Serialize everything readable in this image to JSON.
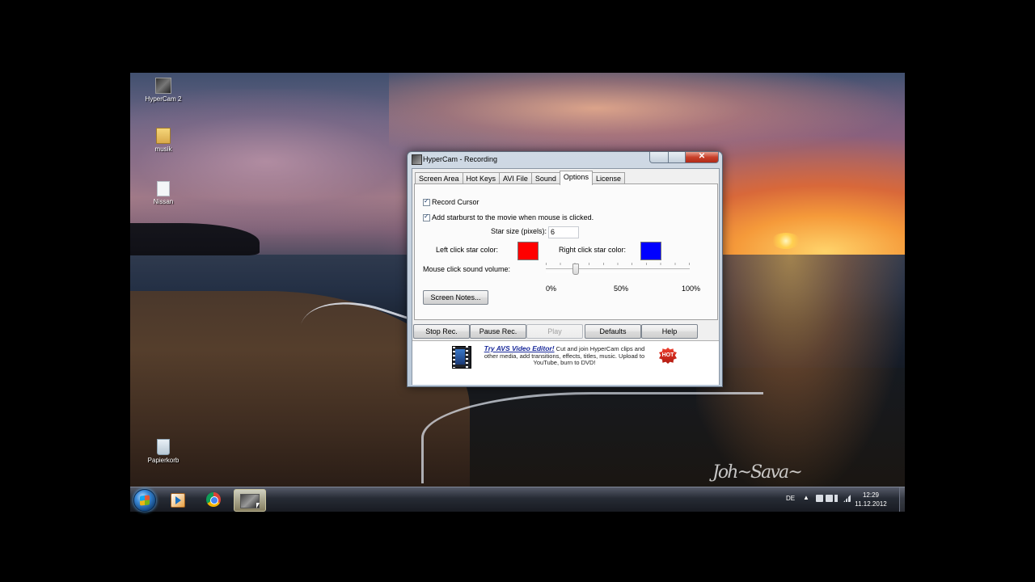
{
  "desktop": {
    "icons": [
      {
        "label": "HyperCam 2",
        "icon": "hypercam-icon"
      },
      {
        "label": "musik",
        "icon": "folder-icon"
      },
      {
        "label": "Nissan",
        "icon": "file-icon"
      },
      {
        "label": "Papierkorb",
        "icon": "recycle-bin-icon"
      }
    ]
  },
  "window": {
    "title": "HyperCam - Recording",
    "close_glyph": "✕",
    "tabs": [
      {
        "label": "Screen Area"
      },
      {
        "label": "Hot Keys"
      },
      {
        "label": "AVI File"
      },
      {
        "label": "Sound"
      },
      {
        "label": "Options",
        "selected": true
      },
      {
        "label": "License"
      }
    ],
    "options": {
      "record_cursor": {
        "label": "Record Cursor",
        "checked": true
      },
      "add_starburst": {
        "label": "Add starburst to the movie when mouse is clicked.",
        "checked": true
      },
      "star_size_label": "Star size (pixels):",
      "star_size_value": "6",
      "left_click_label": "Left click star color:",
      "left_click_color": "#ff0000",
      "right_click_label": "Right click star color:",
      "right_click_color": "#0000ff",
      "volume_label": "Mouse click sound volume:",
      "volume_level": 0.2,
      "volume_ticks": [
        "0%",
        "50%",
        "100%"
      ],
      "screen_notes_label": "Screen Notes..."
    },
    "buttons": {
      "stop": "Stop Rec.",
      "pause": "Pause Rec.",
      "play": "Play",
      "defaults": "Defaults",
      "help": "Help"
    },
    "ad": {
      "link": "Try AVS Video Editor!",
      "line1": "Cut and join HyperCam clips and",
      "line2": "other media, add transitions, effects, titles, music. Upload to",
      "line3": "YouTube, burn to DVD!",
      "badge": "HOT"
    }
  },
  "taskbar": {
    "language": "DE",
    "tray_arrow": "▲",
    "time": "12:29",
    "date": "11.12.2012"
  }
}
